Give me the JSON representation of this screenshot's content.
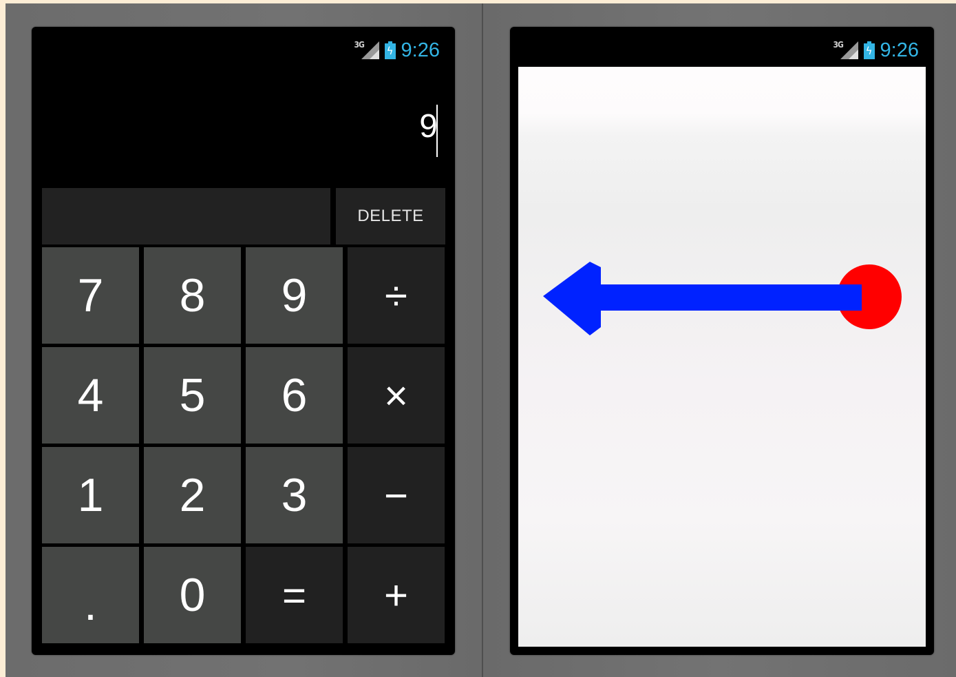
{
  "left_phone": {
    "status": {
      "network": "3G",
      "time": "9:26"
    },
    "display": {
      "value": "9"
    },
    "delete_label": "DELETE",
    "keys": [
      {
        "label": "7",
        "kind": "num"
      },
      {
        "label": "8",
        "kind": "num"
      },
      {
        "label": "9",
        "kind": "num"
      },
      {
        "label": "÷",
        "kind": "op"
      },
      {
        "label": "4",
        "kind": "num"
      },
      {
        "label": "5",
        "kind": "num"
      },
      {
        "label": "6",
        "kind": "num"
      },
      {
        "label": "×",
        "kind": "op"
      },
      {
        "label": "1",
        "kind": "num"
      },
      {
        "label": "2",
        "kind": "num"
      },
      {
        "label": "3",
        "kind": "num"
      },
      {
        "label": "−",
        "kind": "op"
      },
      {
        "label": ".",
        "kind": "num"
      },
      {
        "label": "0",
        "kind": "num"
      },
      {
        "label": "=",
        "kind": "op"
      },
      {
        "label": "+",
        "kind": "op"
      }
    ]
  },
  "right_phone": {
    "status": {
      "network": "3G",
      "time": "9:26"
    },
    "gesture": {
      "direction": "left",
      "arrow_color": "#0022ff",
      "origin_color": "#ff0000"
    }
  },
  "colors": {
    "status_accent": "#33b5e5",
    "num_key": "#454745",
    "op_key": "#212121"
  }
}
